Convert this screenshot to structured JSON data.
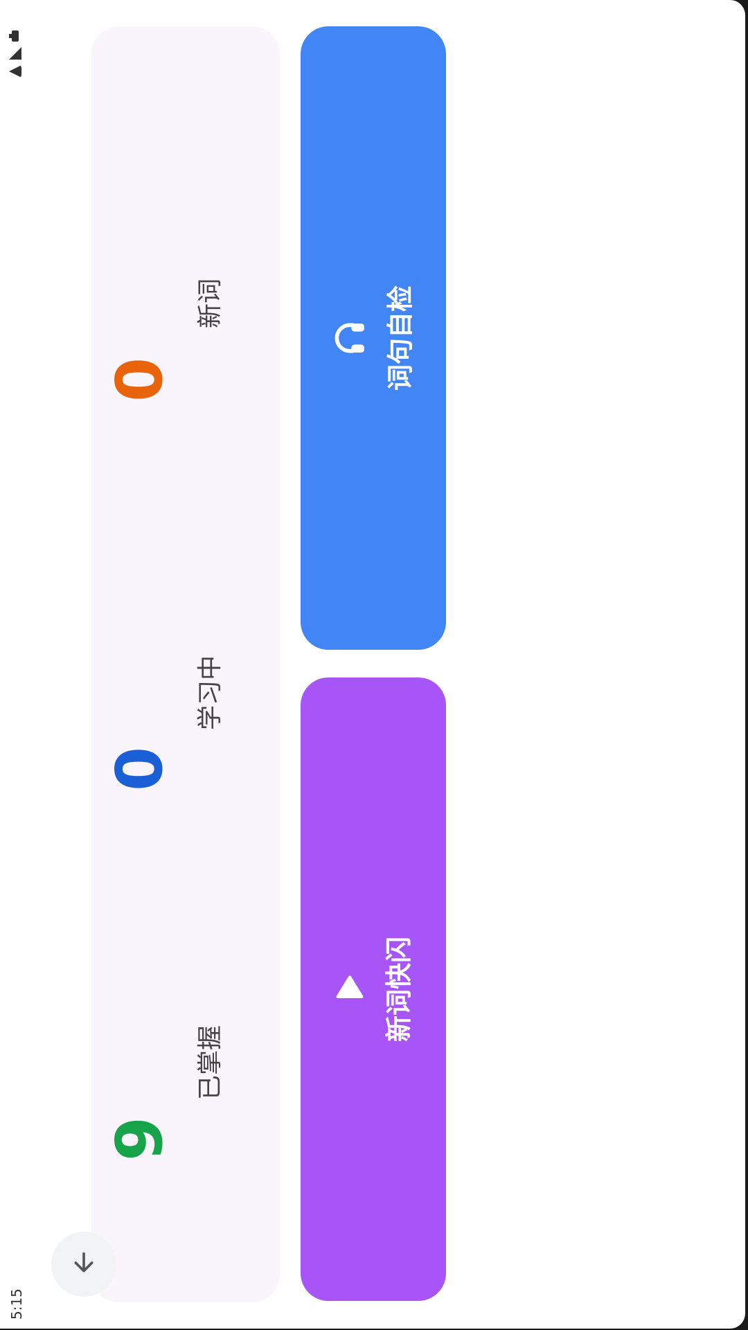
{
  "status_bar": {
    "time": "5:15"
  },
  "stats": [
    {
      "key": "new",
      "value": "0",
      "label": "新词",
      "color": "#e8630a"
    },
    {
      "key": "learning",
      "value": "0",
      "label": "学习中",
      "color": "#1a5fd6"
    },
    {
      "key": "mastered",
      "value": "9",
      "label": "已掌握",
      "color": "#16a34a"
    }
  ],
  "actions": {
    "quiz": {
      "label": "词句自检",
      "icon": "headphones-icon",
      "color": "#4285f4"
    },
    "flash": {
      "label": "新词快闪",
      "icon": "play-icon",
      "color": "#a855f7"
    }
  },
  "fab": {
    "icon": "arrow-down-icon"
  }
}
